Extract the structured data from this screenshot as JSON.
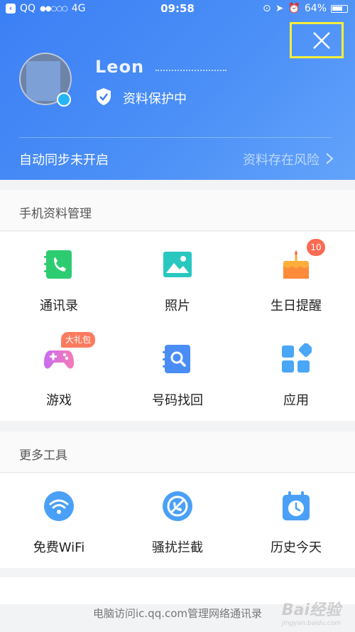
{
  "status_bar": {
    "carrier": "QQ",
    "signal": "●●○○○",
    "network": "4G",
    "time": "09:58",
    "battery": "64%"
  },
  "profile": {
    "username": "Leon",
    "protect_status": "资料保护中",
    "sync_status": "自动同步未开启",
    "risk_link": "资料存在风险"
  },
  "phone_section": {
    "title": "手机资料管理",
    "items": [
      {
        "label": "通讯录",
        "icon": "contacts-icon"
      },
      {
        "label": "照片",
        "icon": "photo-icon"
      },
      {
        "label": "生日提醒",
        "icon": "birthday-cake-icon",
        "badge": "10"
      },
      {
        "label": "游戏",
        "icon": "gamepad-icon",
        "tag": "大礼包"
      },
      {
        "label": "号码找回",
        "icon": "number-recovery-icon"
      },
      {
        "label": "应用",
        "icon": "apps-icon"
      }
    ]
  },
  "tools_section": {
    "title": "更多工具",
    "items": [
      {
        "label": "免费WiFi",
        "icon": "wifi-icon"
      },
      {
        "label": "骚扰拦截",
        "icon": "block-call-icon"
      },
      {
        "label": "历史今天",
        "icon": "calendar-clock-icon"
      }
    ]
  },
  "footer": {
    "note": "电脑访问ic.qq.com管理网络通讯录",
    "watermark": "Bai经验",
    "watermark_sub": "jingyan.baidu.com"
  },
  "colors": {
    "hero_blue": "#3b7ff5",
    "green": "#2ecc71",
    "teal": "#28c8c0",
    "orange": "#fbae3b",
    "purple": "#c76df0",
    "blue": "#4a8df6",
    "badge_red": "#fb6b53",
    "highlight_yellow": "#f4ee3c"
  }
}
